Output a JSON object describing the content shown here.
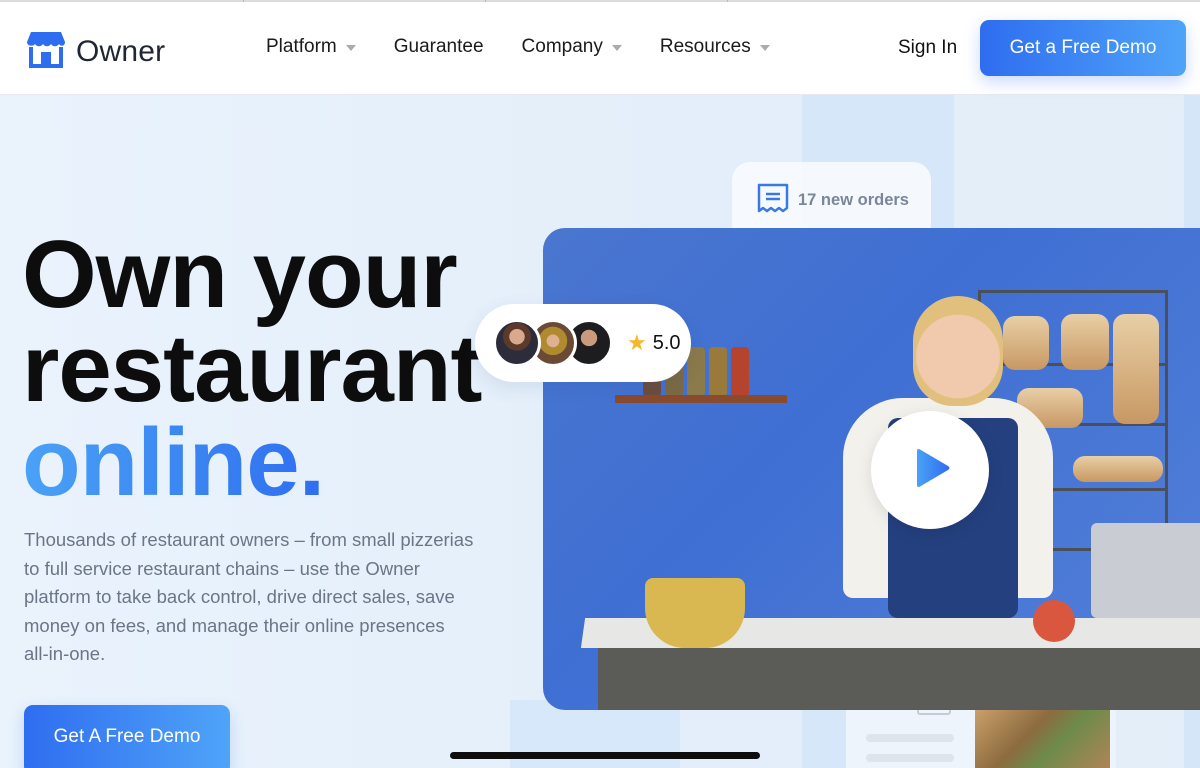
{
  "header": {
    "brand": "Owner",
    "nav": [
      {
        "label": "Platform",
        "has_dropdown": true
      },
      {
        "label": "Guarantee",
        "has_dropdown": false
      },
      {
        "label": "Company",
        "has_dropdown": true
      },
      {
        "label": "Resources",
        "has_dropdown": true
      }
    ],
    "sign_in": "Sign In",
    "cta": "Get a Free Demo"
  },
  "hero": {
    "title_line1": "Own your",
    "title_line2": "restaurant",
    "title_accent": "online.",
    "description": "Thousands of restaurant owners – from small pizzerias to full service restaurant chains – use the Owner platform to take back control, drive direct sales, save money on fees, and manage their online presences all-in-one.",
    "cta": "Get A Free Demo"
  },
  "orders_card": {
    "icon": "receipt-icon",
    "text": "17 new orders"
  },
  "rating": {
    "avatars": [
      "avatar-chef",
      "avatar-woman-beanie",
      "avatar-man"
    ],
    "icon": "star-icon",
    "value": "5.0"
  },
  "video": {
    "play_icon": "play-icon"
  },
  "colors": {
    "brand_blue": "#2f6df0",
    "brand_blue_light": "#4fa4f8",
    "star": "#f4b82d",
    "muted_text": "#6b7585"
  }
}
